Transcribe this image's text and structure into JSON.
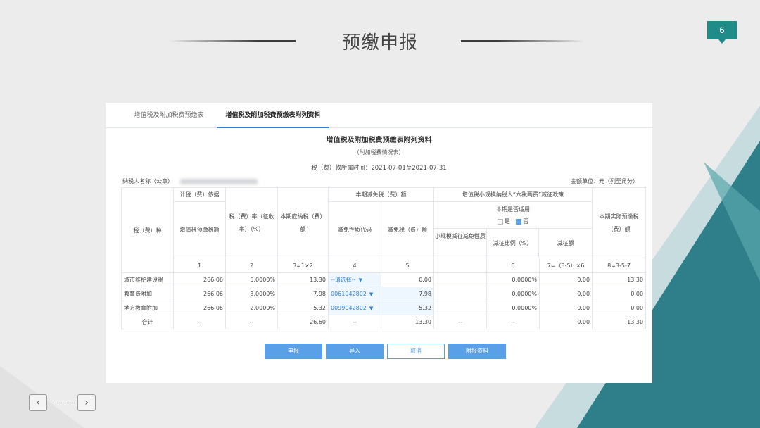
{
  "slide": {
    "title": "预缴申报",
    "page_number": "6"
  },
  "tabs": [
    {
      "label": "增值税及附加税费预缴表"
    },
    {
      "label": "增值税及附加税费预缴表附列资料"
    }
  ],
  "form": {
    "title": "增值税及附加税费预缴表附列资料",
    "subtitle": "（附加税费情况表）",
    "period": "税（费）款所属时间：2021-07-01至2021-07-31",
    "taxpayer_label": "纳税人名称（公章）",
    "unit": "金额单位：元（列至角分）"
  },
  "table": {
    "headers": {
      "tax_type": "税（费）种",
      "basis_group": "计税（费）依据",
      "basis": "增值税预缴税额",
      "rate": "税（费）率（征收率）（%）",
      "payable": "本期应纳税（费）额",
      "reduction_group": "本期减免税（费）额",
      "reduction_code": "减免性质代码",
      "reduction_amount": "减免税（费）额",
      "small_group": "增值税小规模纳税人“六税两费”减征政策",
      "applicable": "本期是否适用",
      "yes": "是",
      "no": "否",
      "small_nature": "小规模减征减免性质",
      "small_ratio": "减征比例（%）",
      "small_amount": "减征额",
      "actual": "本期实际预缴税（费）额"
    },
    "col_numbers": [
      "1",
      "2",
      "3=1×2",
      "4",
      "5",
      "6",
      "7=（3-5）×6",
      "8=3-5-7"
    ],
    "rows": [
      {
        "name": "城市维护建设税",
        "basis": "266.06",
        "rate": "5.0000%",
        "payable": "13.30",
        "code": "--请选择--",
        "reduce": "0.00",
        "nature": "",
        "ratio": "0.0000%",
        "small": "0.00",
        "actual": "13.30"
      },
      {
        "name": "教育费附加",
        "basis": "266.06",
        "rate": "3.0000%",
        "payable": "7.98",
        "code": "0061042802",
        "reduce": "7.98",
        "nature": "",
        "ratio": "0.0000%",
        "small": "0.00",
        "actual": "0.00"
      },
      {
        "name": "地方教育附加",
        "basis": "266.06",
        "rate": "2.0000%",
        "payable": "5.32",
        "code": "0099042802",
        "reduce": "5.32",
        "nature": "",
        "ratio": "0.0000%",
        "small": "0.00",
        "actual": "0.00"
      }
    ],
    "total": {
      "name": "合计",
      "basis": "--",
      "rate": "--",
      "payable": "26.60",
      "code": "--",
      "reduce": "13.30",
      "nature": "--",
      "ratio": "--",
      "small": "0.00",
      "actual": "13.30"
    }
  },
  "buttons": {
    "submit": "申报",
    "import": "导入",
    "cancel": "取消",
    "attach": "附报资料"
  },
  "nav": {
    "prev": "‹",
    "next": "›"
  },
  "colors": {
    "accent": "#1f8c8a",
    "primary": "#5aa0e8",
    "link": "#2e7fd8"
  }
}
